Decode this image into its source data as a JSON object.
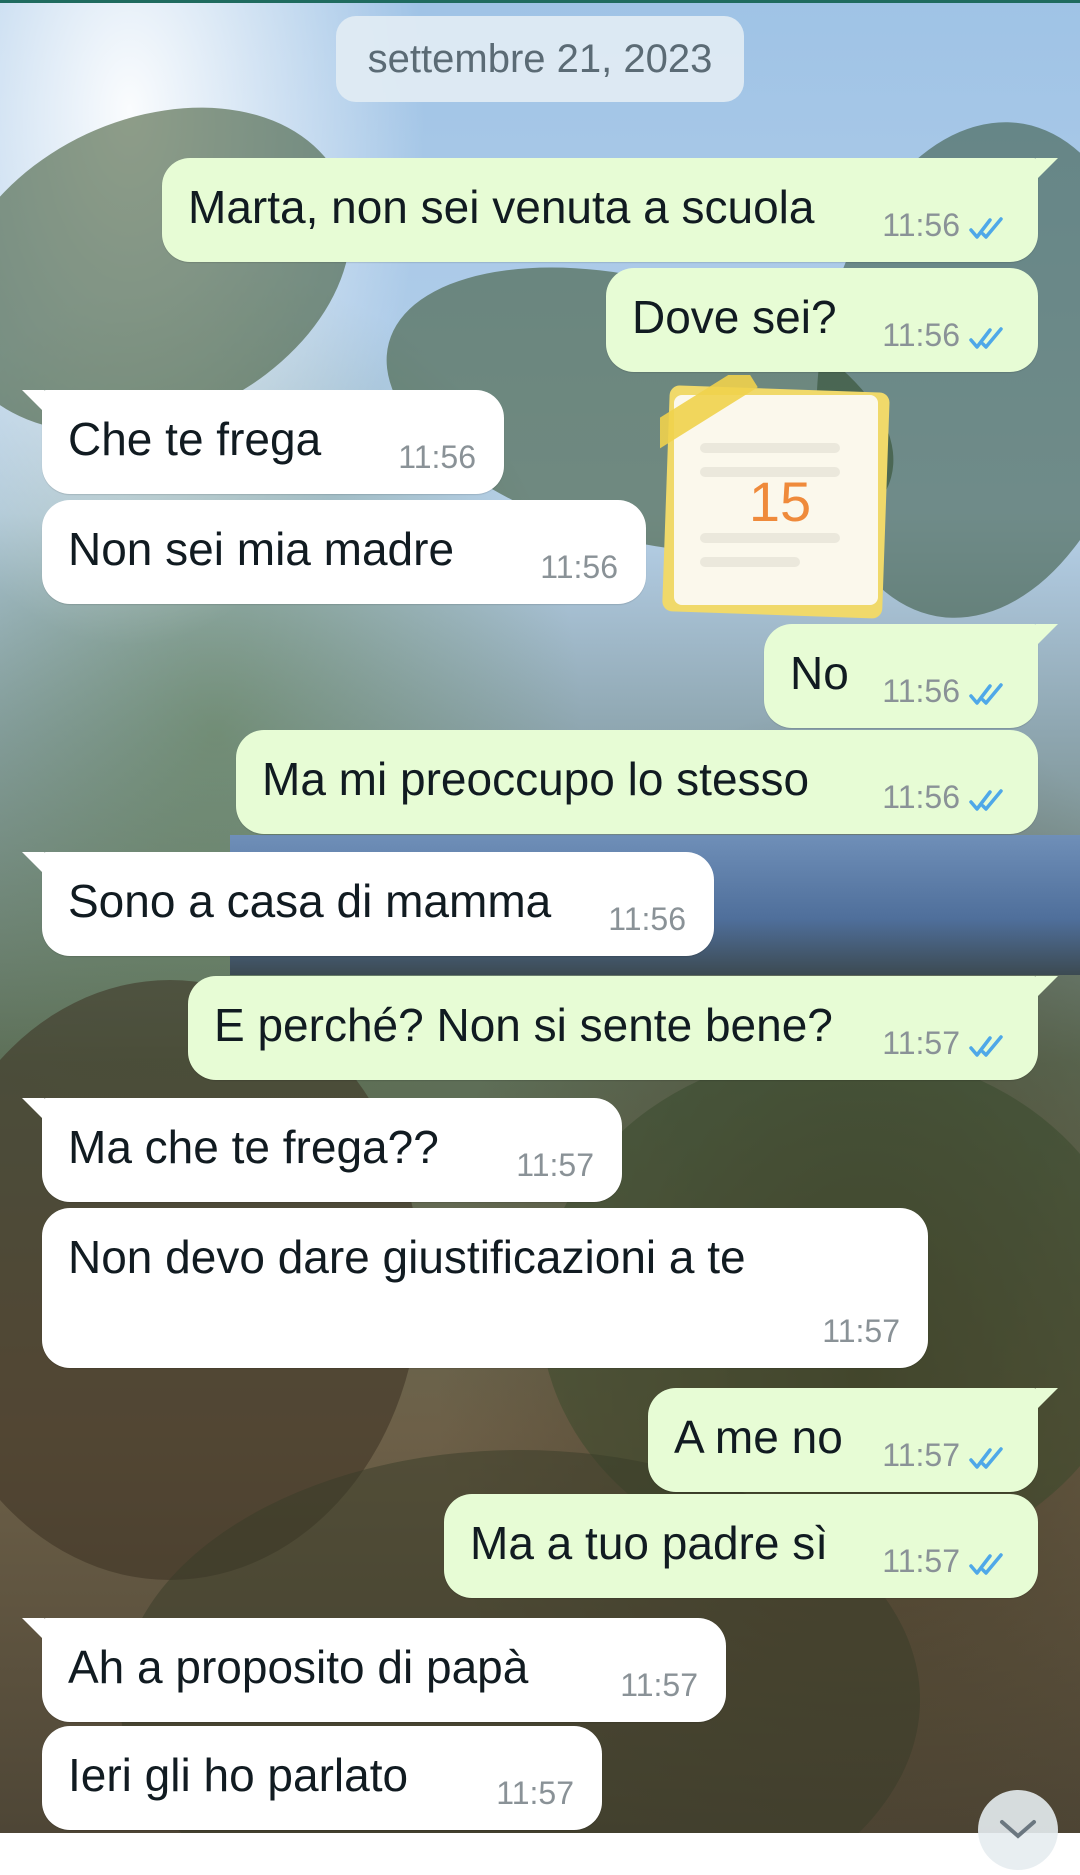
{
  "chat": {
    "date_label": "settembre 21, 2023",
    "sticker_number": "15",
    "messages": [
      {
        "direction": "out",
        "text": "Marta, non sei venuta a scuola",
        "time": "11:56",
        "status": "read"
      },
      {
        "direction": "out",
        "text": "Dove sei?",
        "time": "11:56",
        "status": "read"
      },
      {
        "direction": "in",
        "text": "Che te frega",
        "time": "11:56"
      },
      {
        "direction": "in",
        "text": "Non sei mia madre",
        "time": "11:56"
      },
      {
        "direction": "out",
        "text": "No",
        "time": "11:56",
        "status": "read"
      },
      {
        "direction": "out",
        "text": "Ma mi preoccupo lo stesso",
        "time": "11:56",
        "status": "read"
      },
      {
        "direction": "in",
        "text": "Sono a casa di mamma",
        "time": "11:56"
      },
      {
        "direction": "out",
        "text": "E perché? Non si sente bene?",
        "time": "11:57",
        "status": "read"
      },
      {
        "direction": "in",
        "text": "Ma che te frega??",
        "time": "11:57"
      },
      {
        "direction": "in",
        "text": "Non devo dare giustificazioni a te",
        "time": "11:57"
      },
      {
        "direction": "out",
        "text": "A me no",
        "time": "11:57",
        "status": "read"
      },
      {
        "direction": "out",
        "text": "Ma a tuo padre sì",
        "time": "11:57",
        "status": "read"
      },
      {
        "direction": "in",
        "text": "Ah a proposito di papà",
        "time": "11:57"
      },
      {
        "direction": "in",
        "text": "Ieri gli ho parlato",
        "time": "11:57"
      }
    ]
  },
  "colors": {
    "outgoing_bubble": "#e7fcd5",
    "incoming_bubble": "#ffffff",
    "read_ticks": "#4fa8e8",
    "timestamp": "#8a9297"
  },
  "icons": {
    "read_status": "double-check-icon",
    "scroll_down": "chevron-down-icon"
  }
}
